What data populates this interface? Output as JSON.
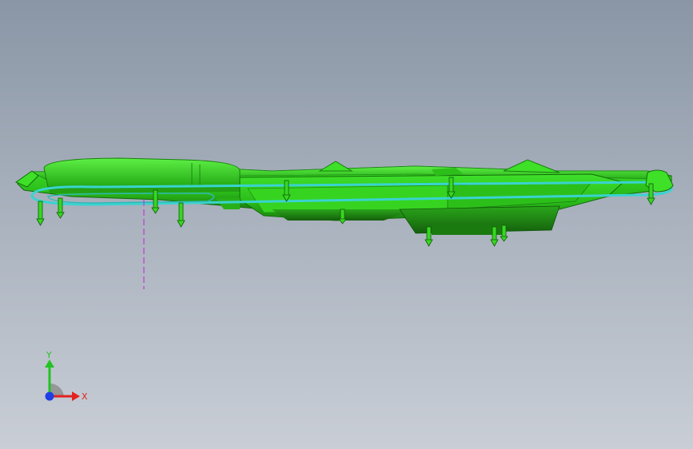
{
  "viewport": {
    "background_top": "#8a96a6",
    "background_bottom": "#c9ced6"
  },
  "model": {
    "part_color": "#33d11f",
    "part_dark": "#1f8f14",
    "part_light": "#6cf05a",
    "ring_color": "#39d3d0",
    "sketch_line_color": "#c23bd6"
  },
  "triad": {
    "x_label": "X",
    "y_label": "Y",
    "x_color": "#e32222",
    "y_color": "#22c322",
    "z_color": "#1f3fe6",
    "plane_icon": "view-plane-icon"
  }
}
